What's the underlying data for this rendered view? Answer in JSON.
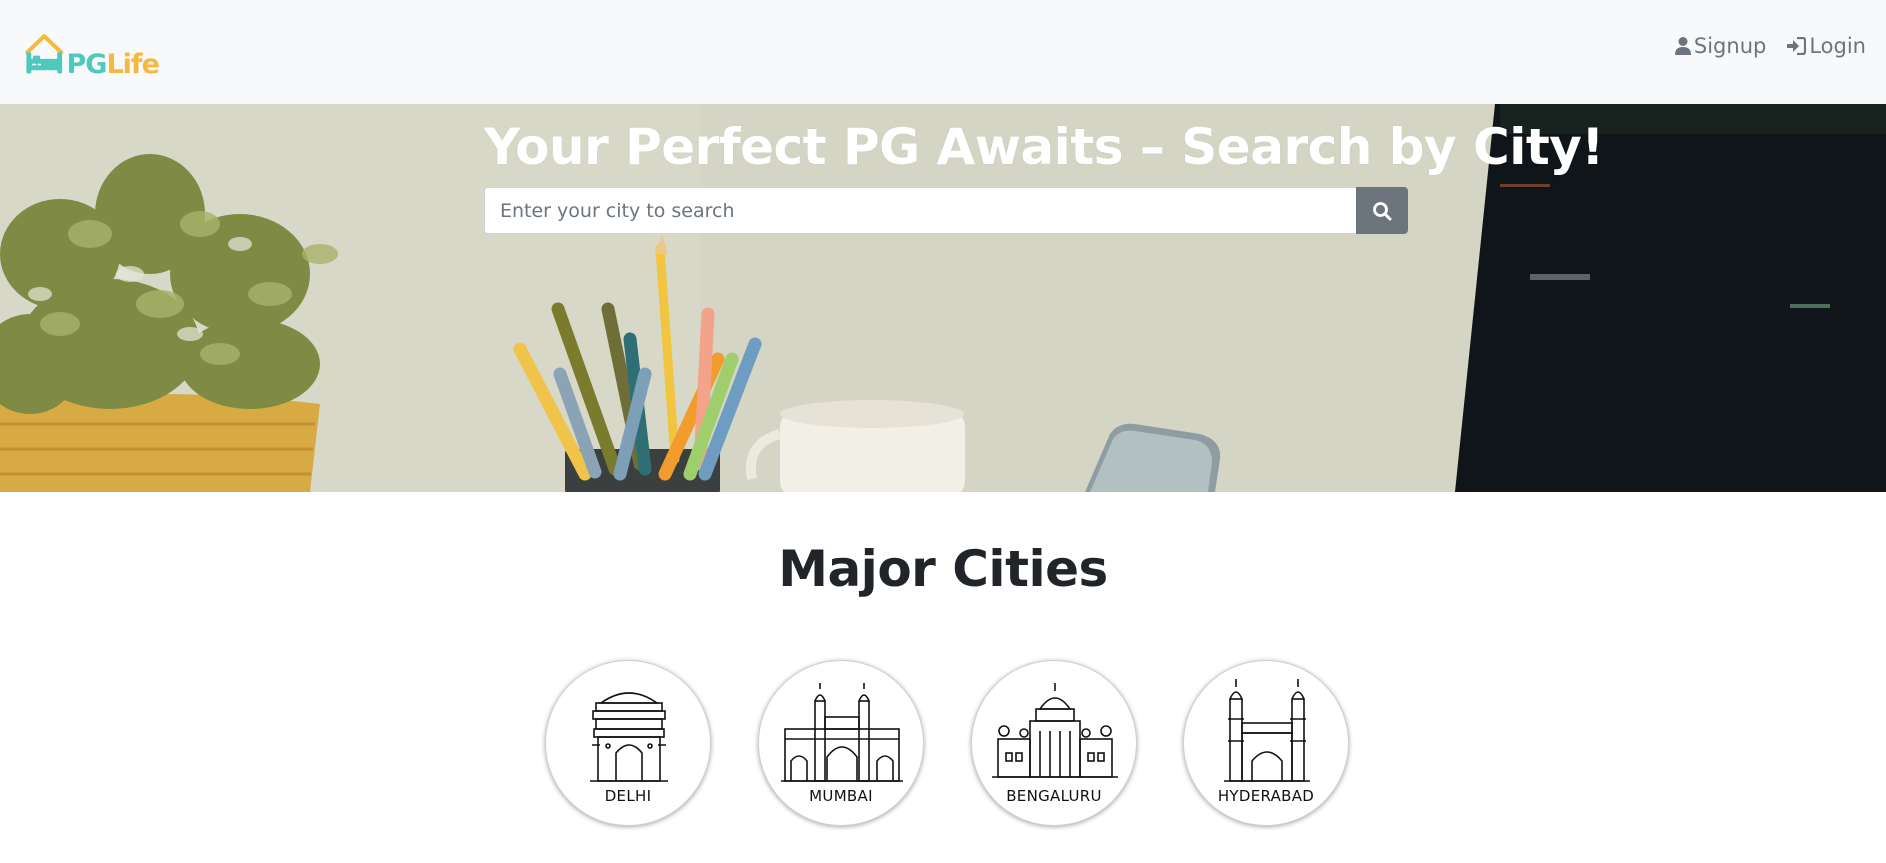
{
  "brand": {
    "name_part1": "PG",
    "name_part2": "Life",
    "colors": {
      "teal": "#4ec9c0",
      "orange": "#f6b93b"
    }
  },
  "nav": {
    "signup": {
      "label": "Signup",
      "icon": "user-icon"
    },
    "login": {
      "label": "Login",
      "icon": "sign-in-icon"
    }
  },
  "banner": {
    "title": "Your Perfect PG Awaits – Search by City!",
    "search": {
      "placeholder": "Enter your city to search",
      "value": "",
      "button_icon": "search-icon"
    }
  },
  "cities": {
    "heading": "Major Cities",
    "items": [
      {
        "name": "DELHI",
        "icon": "india-gate-icon"
      },
      {
        "name": "MUMBAI",
        "icon": "gateway-of-india-icon"
      },
      {
        "name": "BENGALURU",
        "icon": "vidhana-soudha-icon"
      },
      {
        "name": "HYDERABAD",
        "icon": "charminar-icon"
      }
    ]
  },
  "colors": {
    "navbar_bg": "#f8f9fa",
    "search_button": "#6c757d",
    "nav_text": "#6c757d"
  }
}
